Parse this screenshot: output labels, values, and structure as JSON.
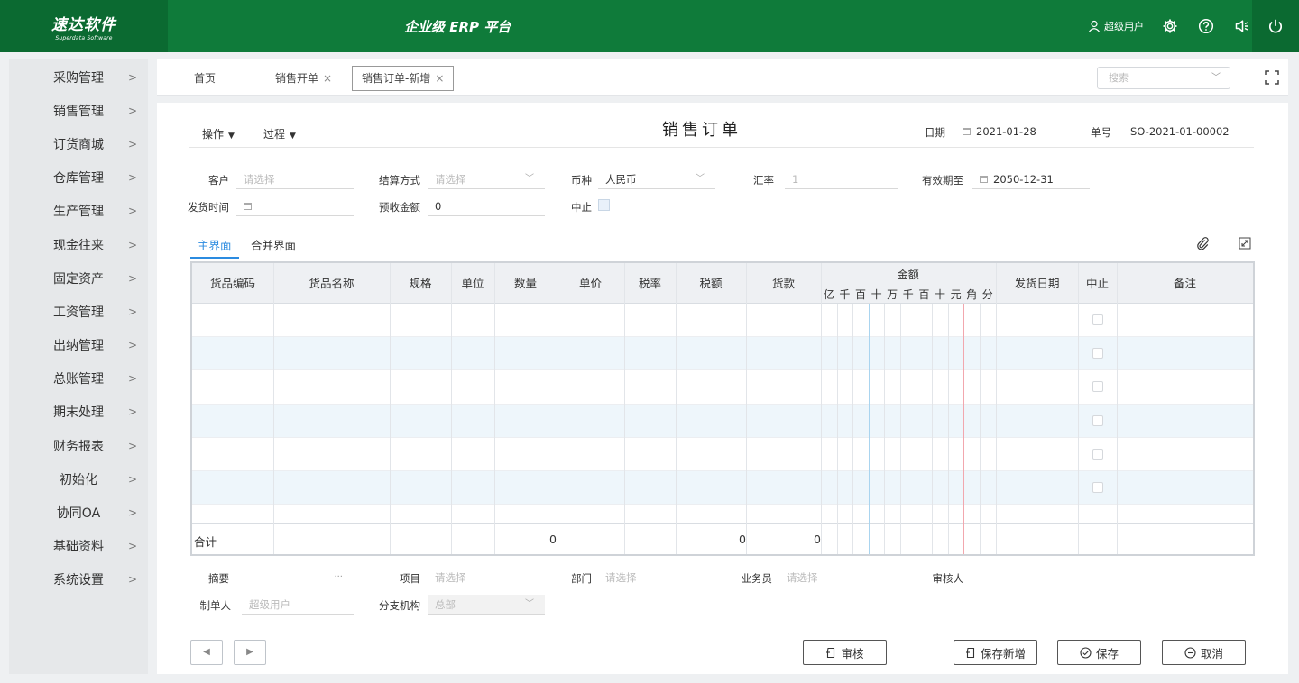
{
  "header": {
    "logo_main": "速达软件",
    "logo_sub": "Superdata Software",
    "platform_title": "企业级 ERP 平台",
    "user_name": "超级用户"
  },
  "sidebar": {
    "items": [
      {
        "label": "采购管理"
      },
      {
        "label": "销售管理"
      },
      {
        "label": "订货商城"
      },
      {
        "label": "仓库管理"
      },
      {
        "label": "生产管理"
      },
      {
        "label": "现金往来"
      },
      {
        "label": "固定资产"
      },
      {
        "label": "工资管理"
      },
      {
        "label": "出纳管理"
      },
      {
        "label": "总账管理"
      },
      {
        "label": "期末处理"
      },
      {
        "label": "财务报表"
      },
      {
        "label": "初始化"
      },
      {
        "label": "协同OA"
      },
      {
        "label": "基础资料"
      },
      {
        "label": "系统设置"
      }
    ],
    "arrow": ">"
  },
  "tabs": {
    "home": "首页",
    "sales_open": "销售开单",
    "sales_order_new": "销售订单-新增",
    "close": "×"
  },
  "search": {
    "placeholder": "搜索"
  },
  "toolbar": {
    "operation": "操作",
    "process": "过程"
  },
  "doc": {
    "title": "销售订单"
  },
  "fields": {
    "date_label": "日期",
    "date_value": "2021-01-28",
    "doc_no_label": "单号",
    "doc_no_value": "SO-2021-01-00002",
    "customer_label": "客户",
    "customer_placeholder": "请选择",
    "settlement_label": "结算方式",
    "settlement_placeholder": "请选择",
    "currency_label": "币种",
    "currency_value": "人民币",
    "rate_label": "汇率",
    "rate_value": "1",
    "valid_until_label": "有效期至",
    "valid_until_value": "2050-12-31",
    "ship_time_label": "发货时间",
    "prepaid_label": "预收金额",
    "prepaid_value": "0",
    "stop_label": "中止"
  },
  "subtabs": {
    "main": "主界面",
    "merged": "合并界面"
  },
  "table": {
    "columns": [
      "货品编码",
      "货品名称",
      "规格",
      "单位",
      "数量",
      "单价",
      "税率",
      "税额",
      "货款"
    ],
    "amount_title": "金额",
    "amount_digits": [
      "亿",
      "千",
      "百",
      "十",
      "万",
      "千",
      "百",
      "十",
      "元",
      "角",
      "分"
    ],
    "columns_right": [
      "发货日期",
      "中止",
      "备注"
    ],
    "total_label": "合计",
    "total_quantity": "0",
    "total_tax": "0",
    "total_payment": "0"
  },
  "footer": {
    "summary_label": "摘要",
    "project_label": "项目",
    "project_placeholder": "请选择",
    "dept_label": "部门",
    "dept_placeholder": "请选择",
    "salesman_label": "业务员",
    "salesman_placeholder": "请选择",
    "auditor_label": "审核人",
    "maker_label": "制单人",
    "maker_value": "超级用户",
    "branch_label": "分支机构",
    "branch_value": "总部"
  },
  "buttons": {
    "prev": "◀",
    "next": "▶",
    "audit": "审核",
    "save_new": "保存新增",
    "save": "保存",
    "cancel": "取消"
  },
  "colors": {
    "brand_green": "#0f7b3a",
    "brand_green_dark": "#0b6a31",
    "accent_blue": "#2b8be0"
  }
}
